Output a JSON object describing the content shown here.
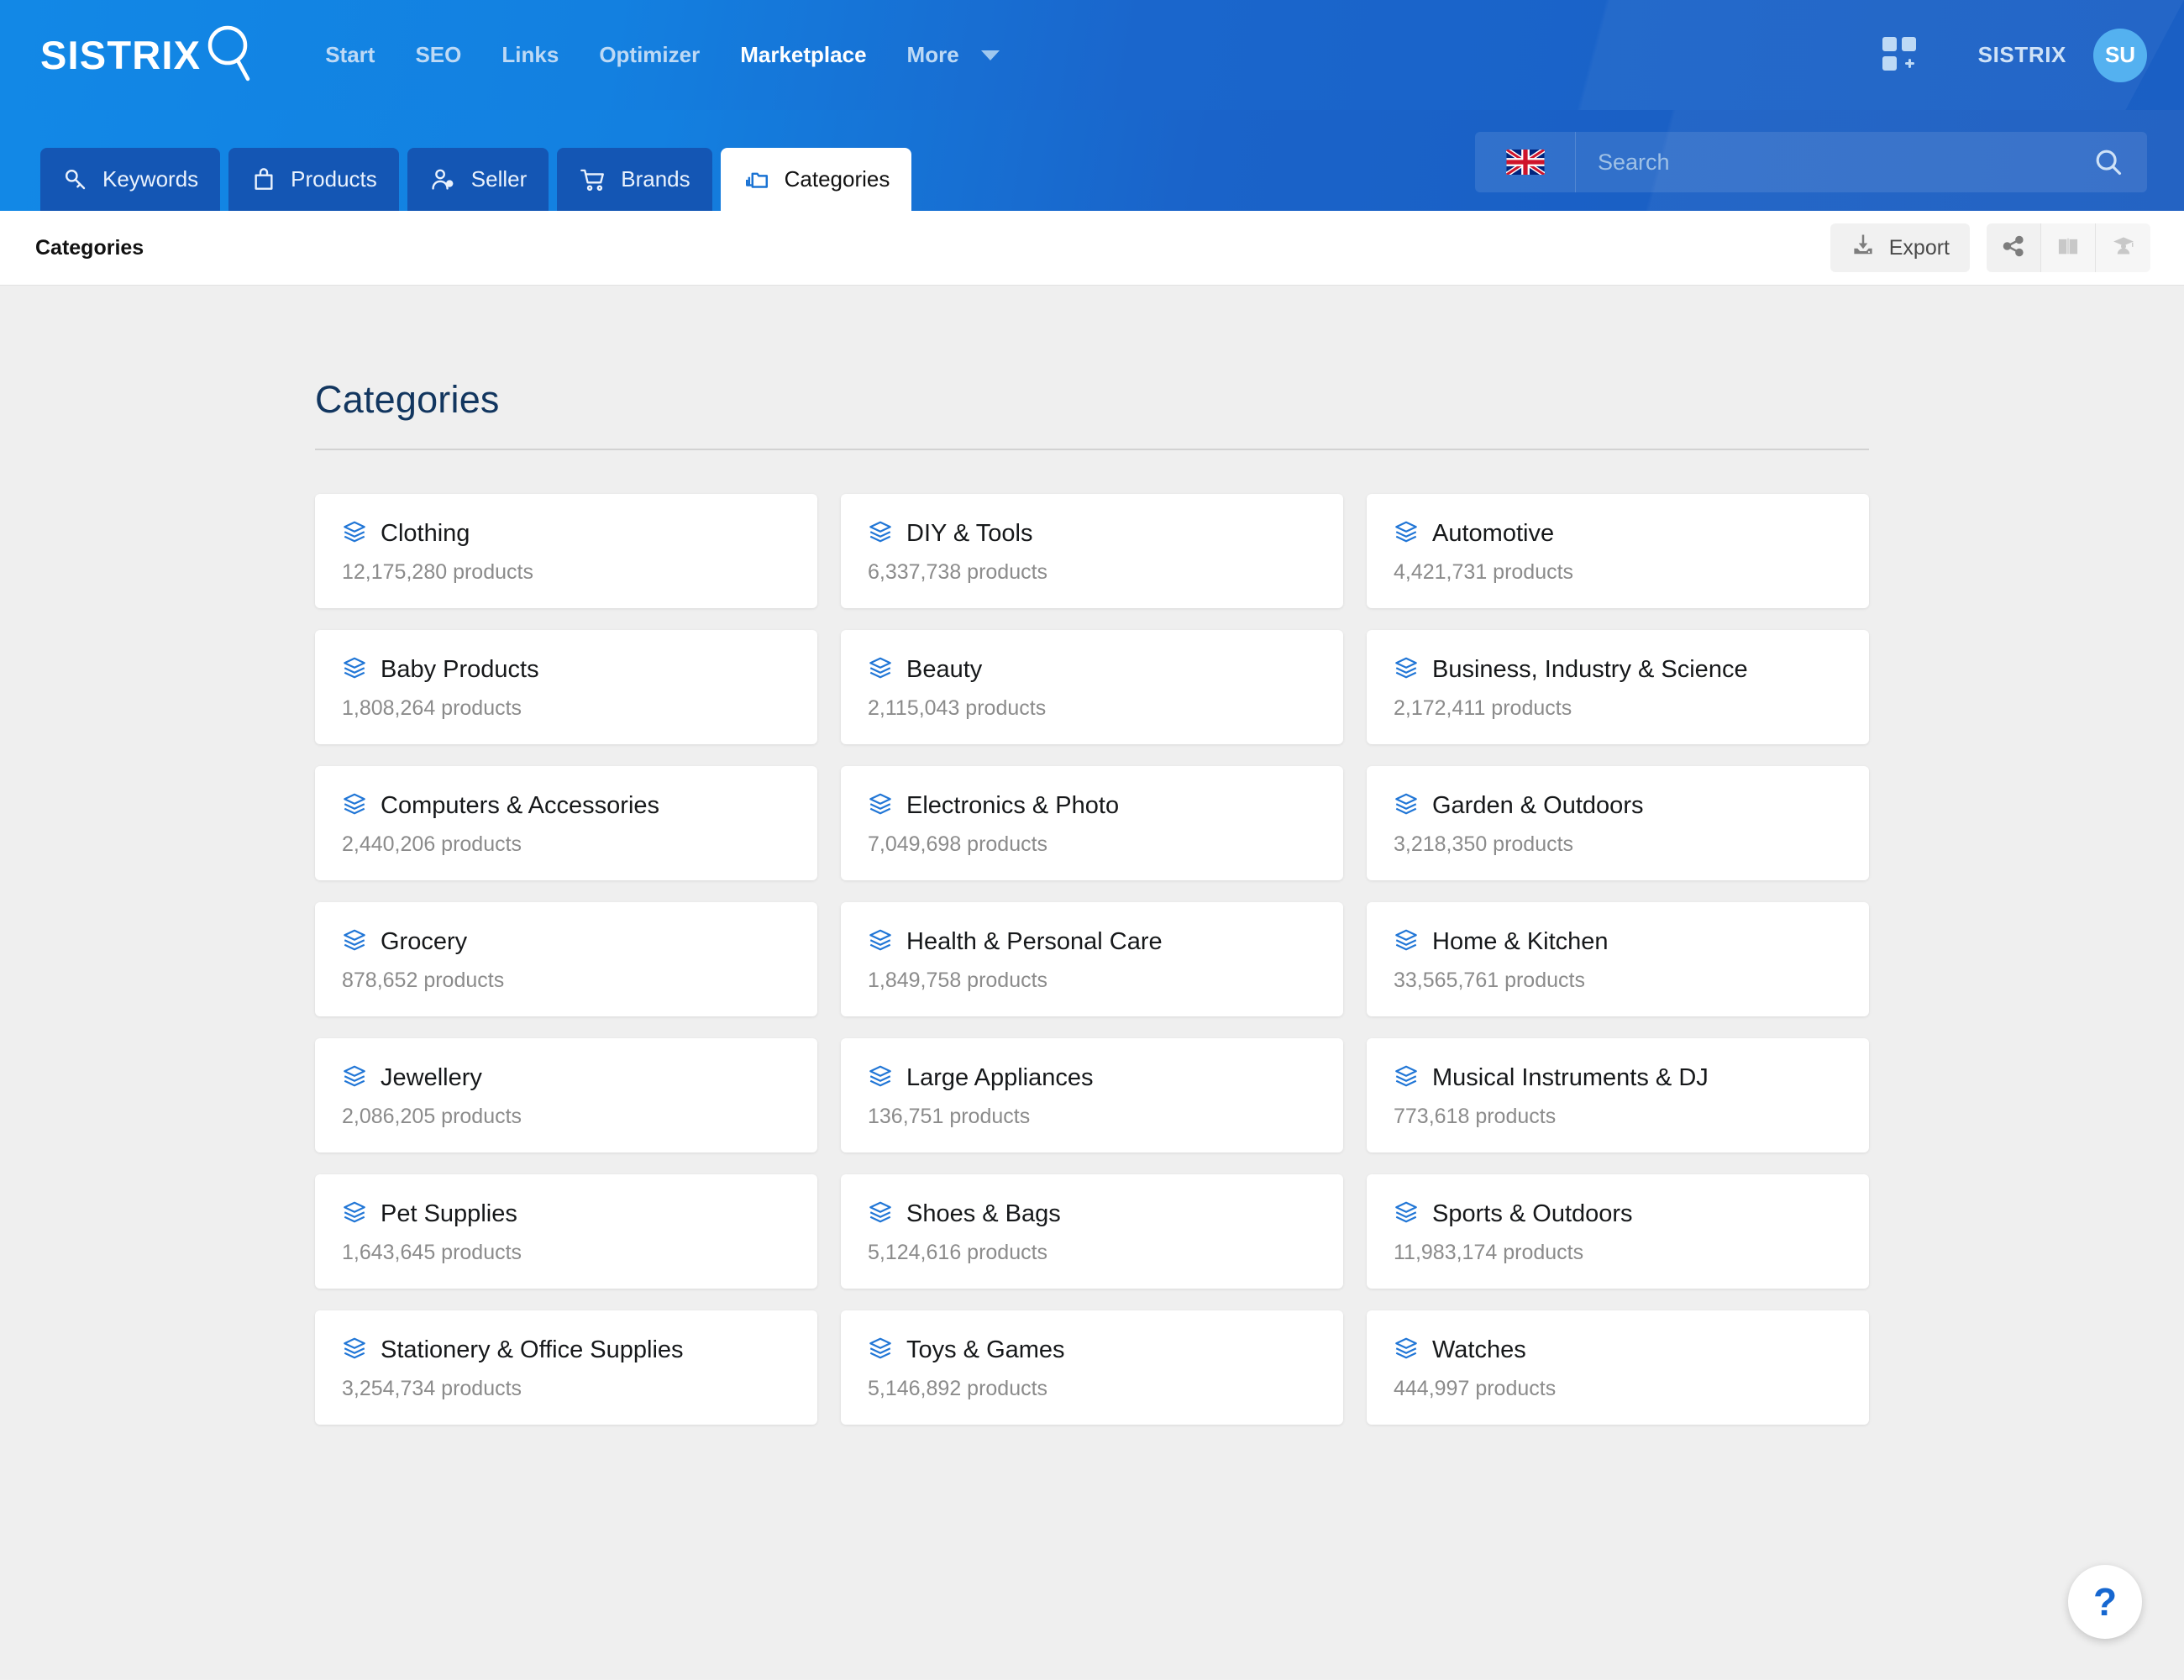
{
  "header": {
    "brand": "SISTRIX",
    "brand_icon": "magnifier-logo-icon",
    "nav": [
      {
        "label": "Start",
        "active": false
      },
      {
        "label": "SEO",
        "active": false
      },
      {
        "label": "Links",
        "active": false
      },
      {
        "label": "Optimizer",
        "active": false
      },
      {
        "label": "Marketplace",
        "active": true
      },
      {
        "label": "More",
        "active": false
      }
    ],
    "apps_icon": "grid-plus-icon",
    "account_name": "SISTRIX",
    "avatar_initials": "SU"
  },
  "subnav": {
    "tabs": [
      {
        "label": "Keywords",
        "icon": "key-icon",
        "active": false
      },
      {
        "label": "Products",
        "icon": "shopping-bag-icon",
        "active": false
      },
      {
        "label": "Seller",
        "icon": "user-tag-icon",
        "active": false
      },
      {
        "label": "Brands",
        "icon": "shopping-cart-icon",
        "active": false
      },
      {
        "label": "Categories",
        "icon": "folders-icon",
        "active": true
      }
    ],
    "search": {
      "placeholder": "Search",
      "value": "",
      "country_flag": "uk-flag-icon",
      "search_icon": "search-icon"
    }
  },
  "toolbar": {
    "title": "Categories",
    "export_label": "Export",
    "export_icon": "download-icon",
    "actions": [
      {
        "icon": "share-icon",
        "name": "share-button"
      },
      {
        "icon": "book-icon",
        "name": "docs-button"
      },
      {
        "icon": "graduation-cap-icon",
        "name": "academy-button"
      }
    ]
  },
  "main": {
    "page_title": "Categories",
    "card_icon": "layers-icon",
    "product_suffix": "products",
    "cards": [
      {
        "title": "Clothing",
        "count": "12,175,280 products"
      },
      {
        "title": "DIY & Tools",
        "count": "6,337,738 products"
      },
      {
        "title": "Automotive",
        "count": "4,421,731 products"
      },
      {
        "title": "Baby Products",
        "count": "1,808,264 products"
      },
      {
        "title": "Beauty",
        "count": "2,115,043 products"
      },
      {
        "title": "Business, Industry & Science",
        "count": "2,172,411 products"
      },
      {
        "title": "Computers & Accessories",
        "count": "2,440,206 products"
      },
      {
        "title": "Electronics & Photo",
        "count": "7,049,698 products"
      },
      {
        "title": "Garden & Outdoors",
        "count": "3,218,350 products"
      },
      {
        "title": "Grocery",
        "count": "878,652 products"
      },
      {
        "title": "Health & Personal Care",
        "count": "1,849,758 products"
      },
      {
        "title": "Home & Kitchen",
        "count": "33,565,761 products"
      },
      {
        "title": "Jewellery",
        "count": "2,086,205 products"
      },
      {
        "title": "Large Appliances",
        "count": "136,751 products"
      },
      {
        "title": "Musical Instruments & DJ",
        "count": "773,618 products"
      },
      {
        "title": "Pet Supplies",
        "count": "1,643,645 products"
      },
      {
        "title": "Shoes & Bags",
        "count": "5,124,616 products"
      },
      {
        "title": "Sports & Outdoors",
        "count": "11,983,174 products"
      },
      {
        "title": "Stationery & Office Supplies",
        "count": "3,254,734 products"
      },
      {
        "title": "Toys & Games",
        "count": "5,146,892 products"
      },
      {
        "title": "Watches",
        "count": "444,997 products"
      }
    ],
    "help_label": "?"
  },
  "colors": {
    "brand_blue": "#1288e6",
    "deep_blue": "#1a5cc0",
    "tab_blue": "#1456b4",
    "accent": "#1a73d4",
    "title_navy": "#12365f",
    "page_bg": "#efefef"
  }
}
